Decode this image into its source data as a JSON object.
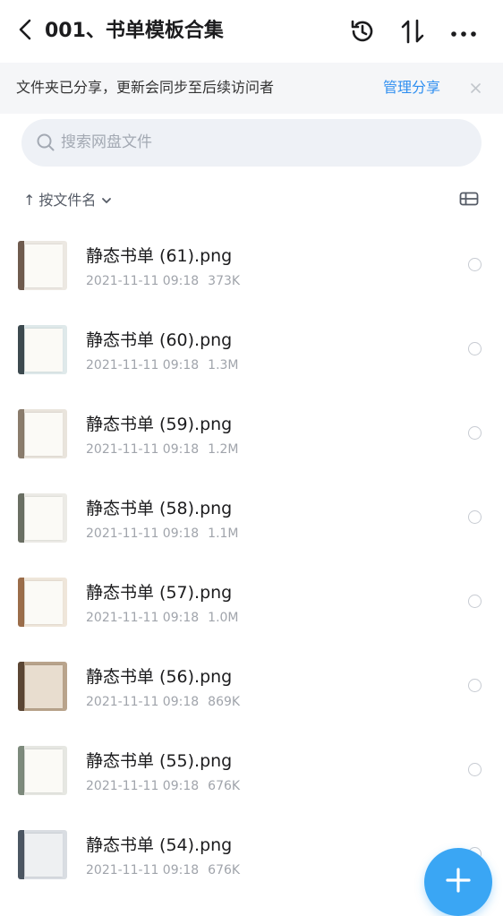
{
  "header": {
    "title": "001、书单模板合集",
    "back_icon": "chevron-left-icon",
    "history_icon": "history-icon",
    "sort_icon": "sort-arrows-icon",
    "more_icon": "more-dots-icon"
  },
  "share_banner": {
    "text": "文件夹已分享，更新会同步至后续访问者",
    "link_label": "管理分享",
    "close_icon": "close-icon"
  },
  "search": {
    "placeholder": "搜索网盘文件",
    "value": ""
  },
  "sort_bar": {
    "arrow": "↑",
    "label": "按文件名",
    "chevron_icon": "chevron-down-icon",
    "view_icon": "list-view-icon"
  },
  "files": [
    {
      "name": "静态书单 (61).png",
      "date": "2021-11-11 09:18",
      "size": "373K"
    },
    {
      "name": "静态书单 (60).png",
      "date": "2021-11-11 09:18",
      "size": "1.3M"
    },
    {
      "name": "静态书单 (59).png",
      "date": "2021-11-11 09:18",
      "size": "1.2M"
    },
    {
      "name": "静态书单 (58).png",
      "date": "2021-11-11 09:18",
      "size": "1.1M"
    },
    {
      "name": "静态书单 (57).png",
      "date": "2021-11-11 09:18",
      "size": "1.0M"
    },
    {
      "name": "静态书单 (56).png",
      "date": "2021-11-11 09:18",
      "size": "869K"
    },
    {
      "name": "静态书单 (55).png",
      "date": "2021-11-11 09:18",
      "size": "676K"
    },
    {
      "name": "静态书单 (54).png",
      "date": "2021-11-11 09:18",
      "size": "676K"
    }
  ],
  "fab": {
    "icon": "plus-icon"
  },
  "colors": {
    "accent": "#2f8ff0",
    "fab": "#3aa6f4",
    "banner_bg": "#f5f6f8",
    "search_bg": "#eef1f6"
  }
}
